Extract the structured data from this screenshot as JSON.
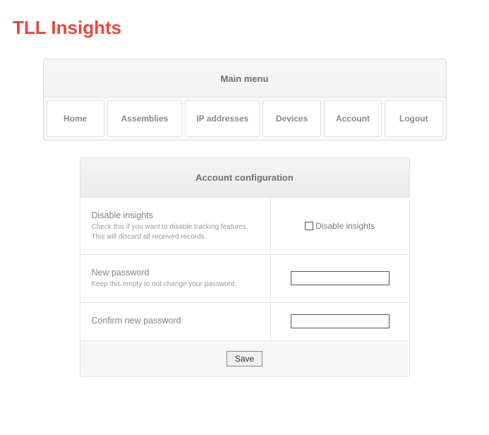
{
  "app": {
    "title": "TLL Insights"
  },
  "menu": {
    "header": "Main menu",
    "items": {
      "home": "Home",
      "assemblies": "Assemblies",
      "ip_addresses": "IP addresses",
      "devices": "Devices",
      "account": "Account",
      "logout": "Logout"
    }
  },
  "config": {
    "header": "Account configuration",
    "disable_insights": {
      "label": "Disable insights",
      "help": "Check this if you want to disable tracking features. This will discard all received records.",
      "checkbox_label": "Disable insights"
    },
    "new_password": {
      "label": "New password",
      "help": "Keep this empty to not change your password."
    },
    "confirm_password": {
      "label": "Confirm new password"
    },
    "save_label": "Save"
  }
}
